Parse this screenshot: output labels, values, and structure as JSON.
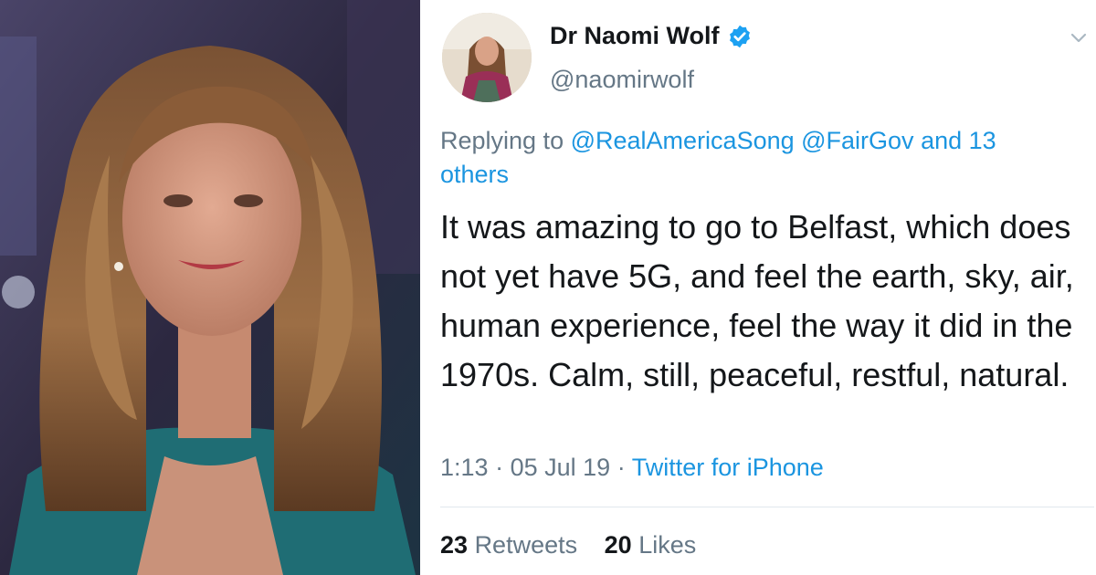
{
  "tweet": {
    "display_name": "Dr Naomi Wolf",
    "handle": "@naomirwolf",
    "reply_prefix": "Replying to",
    "reply_mentions": "@RealAmericaSong @FairGov",
    "reply_others": "and 13 others",
    "text": "It was amazing to go to Belfast, which does not yet have 5G, and feel the earth, sky, air, human experience, feel the way it did in the 1970s. Calm, still, peaceful, restful, natural.",
    "time": "1:13",
    "date": "05 Jul 19",
    "source": "Twitter for iPhone",
    "retweets_count": "23",
    "retweets_label": "Retweets",
    "likes_count": "20",
    "likes_label": "Likes"
  },
  "icons": {
    "verified": "verified-badge-icon",
    "menu": "chevron-down-icon"
  },
  "colors": {
    "link": "#1b95e0",
    "secondary_text": "#657786",
    "primary_text": "#14171a",
    "verified": "#1da1f2"
  }
}
